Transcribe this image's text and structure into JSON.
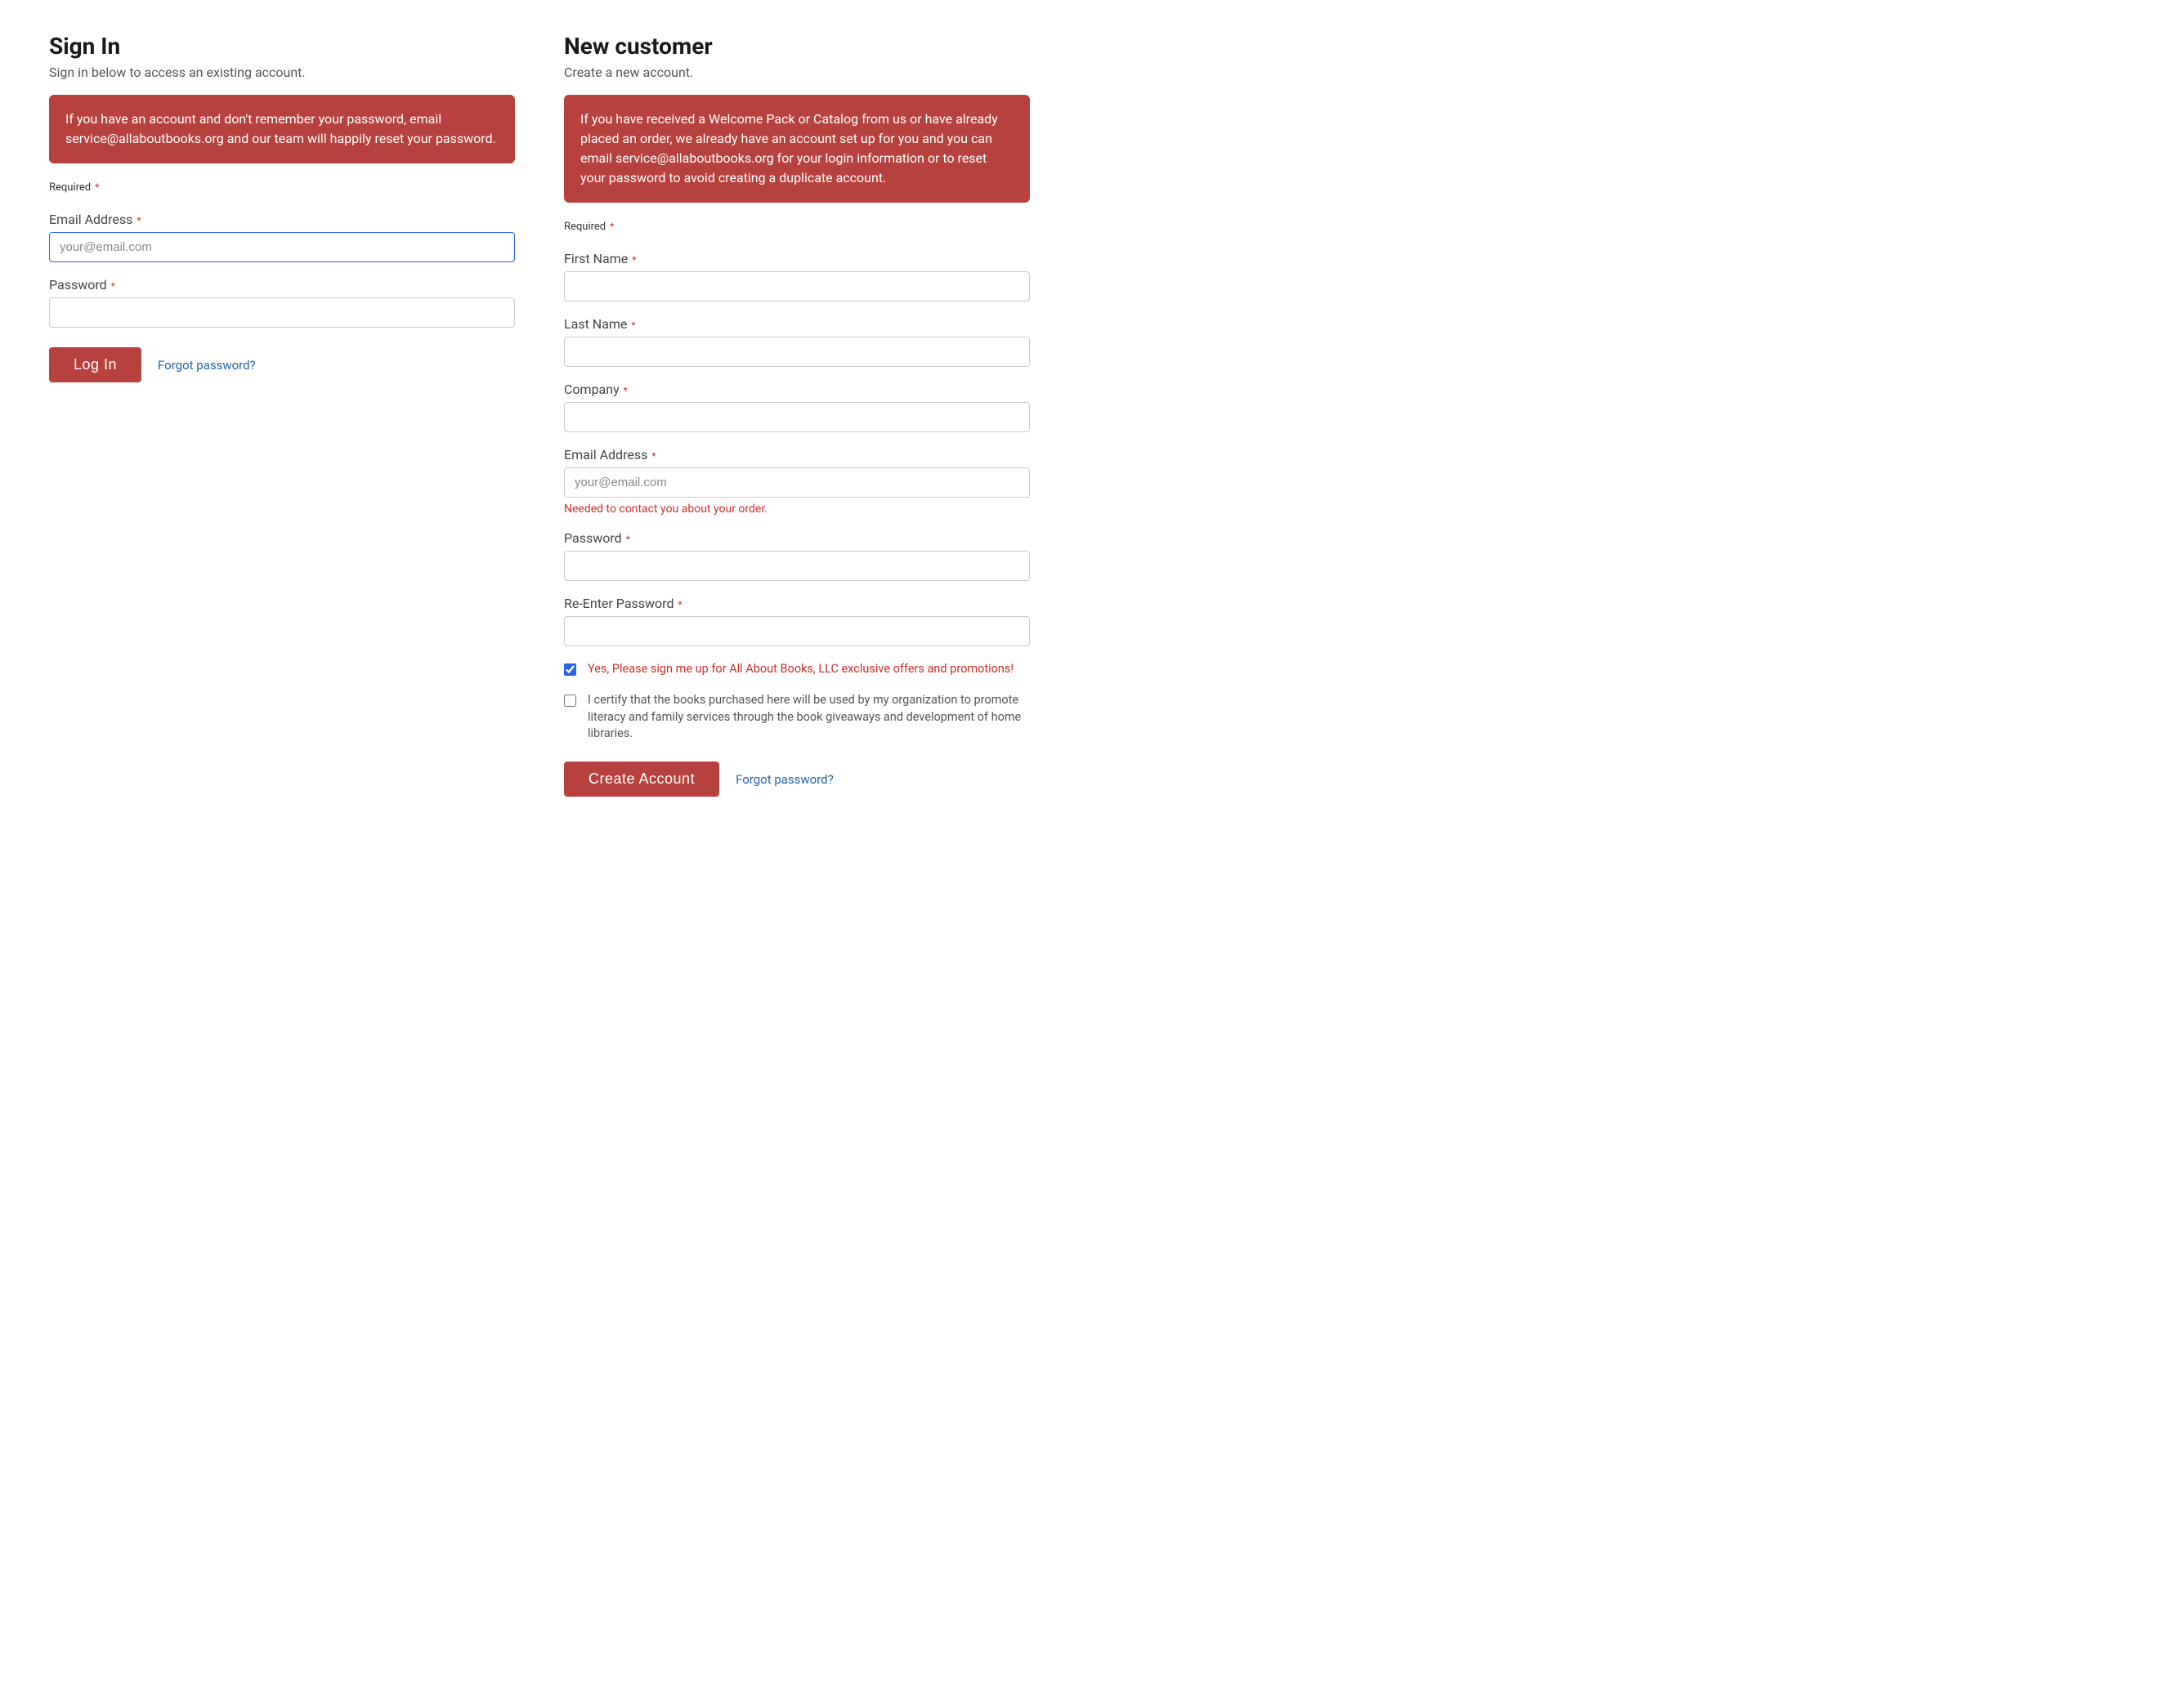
{
  "signin": {
    "title": "Sign In",
    "subtitle": "Sign in below to access an existing account.",
    "alert": "If you have an account and don't remember your password, email service@allaboutbooks.org and our team will happily reset your password.",
    "required_note": "Required",
    "email_label": "Email Address",
    "email_placeholder": "your@email.com",
    "password_label": "Password",
    "login_button": "Log In",
    "forgot_link": "Forgot password?"
  },
  "newcustomer": {
    "title": "New customer",
    "subtitle": "Create a new account.",
    "alert": "If you have received a Welcome Pack or Catalog from us or have already placed an order, we already have an account set up for you and you can email service@allaboutbooks.org for your login information or to reset your password to avoid creating a duplicate account.",
    "required_note": "Required",
    "first_name_label": "First Name",
    "last_name_label": "Last Name",
    "company_label": "Company",
    "email_label": "Email Address",
    "email_placeholder": "your@email.com",
    "email_help": "Needed to contact you about your order.",
    "password_label": "Password",
    "reenter_password_label": "Re-Enter Password",
    "checkbox_offers": "Yes, Please sign me up for All About Books, LLC exclusive offers and promotions!",
    "checkbox_certify": "I certify that the books purchased here will be used by my organization to promote literacy and family services through the book giveaways and development of home libraries.",
    "create_button": "Create Account",
    "forgot_link": "Forgot password?"
  }
}
